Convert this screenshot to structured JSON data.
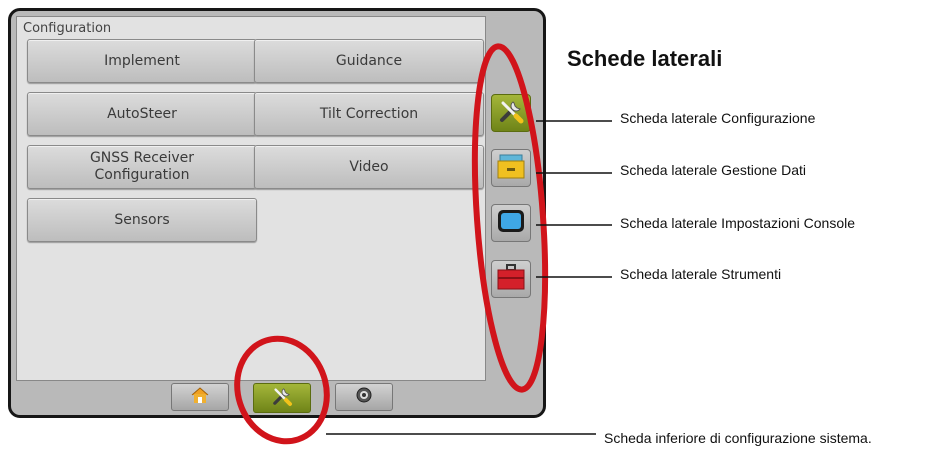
{
  "screen": {
    "panel_title": "Configuration",
    "buttons": [
      {
        "label": "Implement"
      },
      {
        "label": "Guidance"
      },
      {
        "label": "AutoSteer"
      },
      {
        "label": "Tilt Correction"
      },
      {
        "label": "GNSS Receiver\nConfiguration"
      },
      {
        "label": "Video"
      },
      {
        "label": "Sensors"
      }
    ],
    "side_tabs": [
      {
        "icon": "tools-icon",
        "active": true
      },
      {
        "icon": "data-folder-icon",
        "active": false
      },
      {
        "icon": "console-screen-icon",
        "active": false
      },
      {
        "icon": "toolbox-icon",
        "active": false
      }
    ],
    "bottom_tabs": [
      {
        "icon": "home-icon",
        "active": false
      },
      {
        "icon": "tools-icon",
        "active": true
      },
      {
        "icon": "gauge-icon",
        "active": false
      }
    ]
  },
  "annotations": {
    "title": "Schede laterali",
    "labels": [
      "Scheda laterale Configurazione",
      "Scheda laterale Gestione Dati",
      "Scheda laterale Impostazioni Console",
      "Scheda laterale Strumenti"
    ],
    "bottom_label": "Scheda inferiore di configurazione sistema."
  },
  "colors": {
    "highlight_ellipse": "#d1141b",
    "active_tab": "#8ca01f",
    "screen_border": "#161616"
  }
}
